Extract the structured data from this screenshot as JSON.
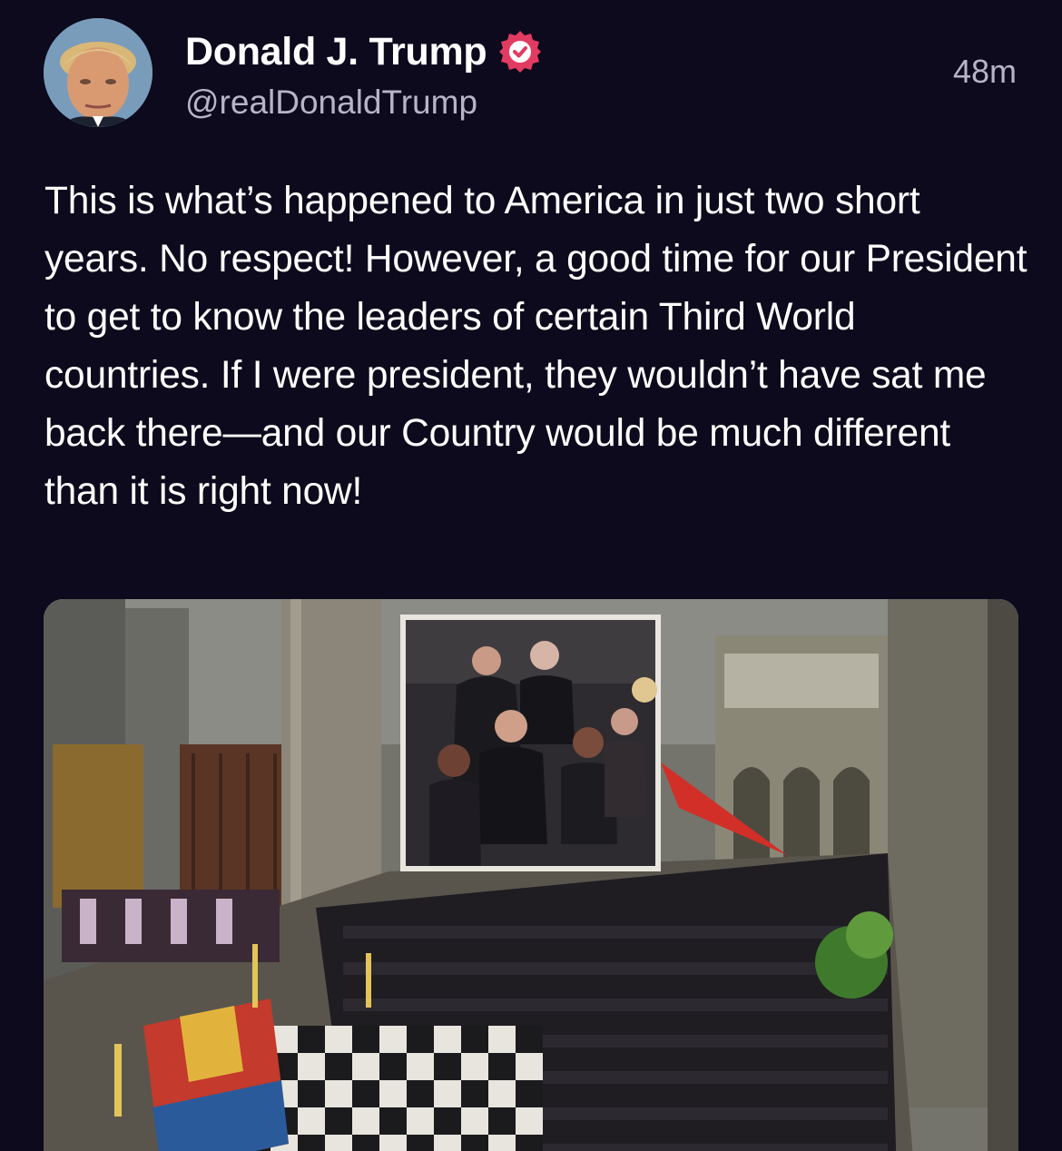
{
  "post": {
    "author": {
      "display_name": "Donald J. Trump",
      "handle": "@realDonaldTrump",
      "verified": true,
      "verified_icon": "verified-badge-icon",
      "avatar": "profile-avatar"
    },
    "timestamp": "48m",
    "text": "This is what’s happened to America in just two short years. No respect! However, a good time for our President to get to know the leaders of certain Third World countries. If I were president, they wouldn’t have sat me back there—and our Country would be much different than it is right now!",
    "media": {
      "type": "image",
      "subject": "attached-photo"
    }
  },
  "colors": {
    "background": "#0c0a1c",
    "text_primary": "#ffffff",
    "text_secondary": "#b7b4c8",
    "verified_badge": "#e23b62"
  }
}
